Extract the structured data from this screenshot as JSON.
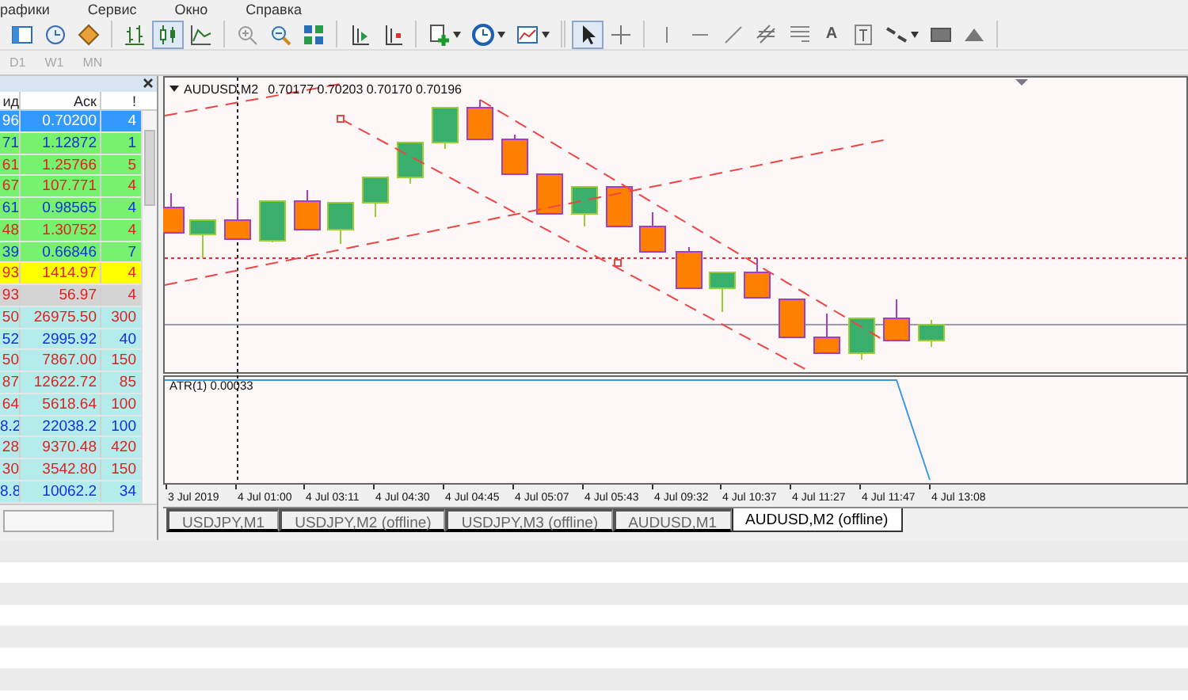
{
  "menu_bar": {
    "items": [
      "рафики",
      "Сервис",
      "Окно",
      "Справка"
    ]
  },
  "toolbar": {
    "groups": [
      [
        {
          "kind": "window",
          "pressed": false,
          "has_menu": false
        },
        {
          "kind": "clock",
          "pressed": false,
          "has_menu": false
        },
        {
          "kind": "tag",
          "pressed": false,
          "has_menu": false
        }
      ],
      [
        {
          "kind": "bar_chart",
          "pressed": false,
          "has_menu": false
        },
        {
          "kind": "candlestick",
          "pressed": true,
          "has_menu": false
        },
        {
          "kind": "line_chart",
          "pressed": false,
          "has_menu": false
        }
      ],
      [
        {
          "kind": "zoom_in",
          "pressed": false,
          "has_menu": false
        },
        {
          "kind": "zoom_out",
          "pressed": false,
          "has_menu": false
        },
        {
          "kind": "tiles",
          "pressed": false,
          "has_menu": false
        }
      ],
      [
        {
          "kind": "autoscroll",
          "pressed": false,
          "has_menu": false
        },
        {
          "kind": "shift",
          "pressed": false,
          "has_menu": false
        }
      ],
      [
        {
          "kind": "add",
          "pressed": false,
          "has_menu": true
        },
        {
          "kind": "period",
          "pressed": false,
          "has_menu": true
        },
        {
          "kind": "template",
          "pressed": false,
          "has_menu": true
        }
      ],
      [
        {
          "kind": "cursor",
          "pressed": true,
          "has_menu": false
        },
        {
          "kind": "crosshair",
          "pressed": false,
          "has_menu": false
        }
      ],
      [
        {
          "kind": "vline",
          "pressed": false,
          "has_menu": false
        },
        {
          "kind": "hline",
          "pressed": false,
          "has_menu": false
        },
        {
          "kind": "trendline",
          "pressed": false,
          "has_menu": false
        },
        {
          "kind": "channel",
          "pressed": false,
          "has_menu": false
        },
        {
          "kind": "fibo",
          "pressed": false,
          "has_menu": false
        },
        {
          "kind": "text",
          "label": "A",
          "pressed": false,
          "has_menu": false
        },
        {
          "kind": "label",
          "pressed": false,
          "has_menu": false
        },
        {
          "kind": "arrows",
          "pressed": false,
          "has_menu": true
        },
        {
          "kind": "rectangle",
          "pressed": false,
          "has_menu": false
        },
        {
          "kind": "triangle",
          "pressed": false,
          "has_menu": false
        }
      ]
    ]
  },
  "timeframes": [
    {
      "label": "D1",
      "disabled": true
    },
    {
      "label": "W1",
      "disabled": true
    },
    {
      "label": "MN",
      "disabled": true
    }
  ],
  "market_watch": {
    "columns": [
      "ид",
      "Аск",
      "!"
    ],
    "rows": [
      {
        "bid": "96",
        "ask": "0.70200",
        "spread": "4",
        "selected": true,
        "color": "#3399ff"
      },
      {
        "bid": "71",
        "ask": "1.12872",
        "spread": "1",
        "selected": false,
        "color": "#77f26e",
        "kind": "up"
      },
      {
        "bid": "61",
        "ask": "1.25766",
        "spread": "5",
        "selected": false,
        "color": "#77f26e",
        "kind": "down"
      },
      {
        "bid": "67",
        "ask": "107.771",
        "spread": "4",
        "selected": false,
        "color": "#77f26e",
        "kind": "down"
      },
      {
        "bid": "61",
        "ask": "0.98565",
        "spread": "4",
        "selected": false,
        "color": "#77f26e",
        "kind": "up"
      },
      {
        "bid": "48",
        "ask": "1.30752",
        "spread": "4",
        "selected": false,
        "color": "#77f26e",
        "kind": "down"
      },
      {
        "bid": "39",
        "ask": "0.66846",
        "spread": "7",
        "selected": false,
        "color": "#77f26e",
        "kind": "up"
      },
      {
        "bid": "93",
        "ask": "1414.97",
        "spread": "4",
        "selected": false,
        "color": "#ffff00",
        "kind": "down"
      },
      {
        "bid": "93",
        "ask": "56.97",
        "spread": "4",
        "selected": false,
        "color": "#d4d4d4",
        "kind": "down"
      },
      {
        "bid": "50",
        "ask": "26975.50",
        "spread": "300",
        "selected": false,
        "color": "#b4ecec",
        "kind": "down"
      },
      {
        "bid": "52",
        "ask": "2995.92",
        "spread": "40",
        "selected": false,
        "color": "#b4ecec",
        "kind": "up"
      },
      {
        "bid": "50",
        "ask": "7867.00",
        "spread": "150",
        "selected": false,
        "color": "#b4ecec",
        "kind": "down"
      },
      {
        "bid": "87",
        "ask": "12622.72",
        "spread": "85",
        "selected": false,
        "color": "#b4ecec",
        "kind": "down"
      },
      {
        "bid": "64",
        "ask": "5618.64",
        "spread": "100",
        "selected": false,
        "color": "#b4ecec",
        "kind": "down"
      },
      {
        "bid": "8.2",
        "ask": "22038.2",
        "spread": "100",
        "selected": false,
        "color": "#b4ecec",
        "kind": "up"
      },
      {
        "bid": "28",
        "ask": "9370.48",
        "spread": "420",
        "selected": false,
        "color": "#b4ecec",
        "kind": "down"
      },
      {
        "bid": "30",
        "ask": "3542.80",
        "spread": "150",
        "selected": false,
        "color": "#b4ecec",
        "kind": "down"
      },
      {
        "bid": "8.8",
        "ask": "10062.2",
        "spread": "34",
        "selected": false,
        "color": "#b4ecec",
        "kind": "up"
      }
    ]
  },
  "chart": {
    "symbol": "AUDUSD,M2",
    "ohlc": "0.70177 0.70203 0.70170 0.70196",
    "indicator_label": "ATR(1) 0.00033",
    "time_labels": [
      "3 Jul 2019",
      "4 Jul 01:00",
      "4 Jul 03:11",
      "4 Jul 04:30",
      "4 Jul 04:45",
      "4 Jul 05:07",
      "4 Jul 05:43",
      "4 Jul 09:32",
      "4 Jul 10:37",
      "4 Jul 11:27",
      "4 Jul 11:47",
      "4 Jul 13:08"
    ]
  },
  "chart_tabs": [
    {
      "label": "USDJPY,M1",
      "selected": false
    },
    {
      "label": "USDJPY,M2 (offline)",
      "selected": false
    },
    {
      "label": "USDJPY,M3 (offline)",
      "selected": false
    },
    {
      "label": "AUDUSD,M1",
      "selected": false
    },
    {
      "label": "AUDUSD,M2 (offline)",
      "selected": true
    }
  ]
}
